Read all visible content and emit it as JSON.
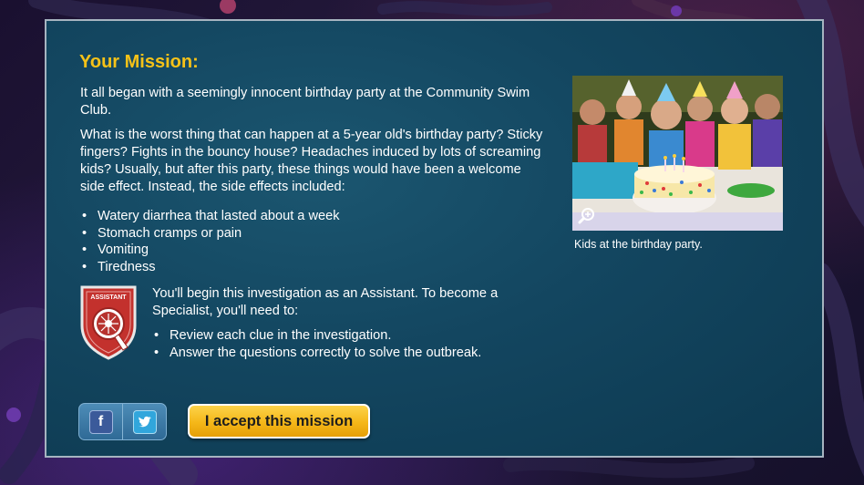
{
  "mission": {
    "title": "Your Mission:",
    "intro": "It all began with a seemingly innocent birthday party at the Community Swim Club.",
    "question": "What is the worst thing that can happen at a 5-year old's birthday party? Sticky fingers? Fights in the bouncy house? Headaches induced by lots of screaming kids? Usually, but after this party, these things would have been a welcome side effect. Instead, the side effects included:",
    "symptoms": [
      "Watery diarrhea that lasted about a week",
      "Stomach cramps or pain",
      "Vomiting",
      "Tiredness"
    ],
    "badge_label": "ASSISTANT",
    "role_text": "You'll begin this investigation as an Assistant. To become a Specialist, you'll need to:",
    "tasks": [
      "Review each clue in the investigation.",
      "Answer the questions correctly to solve the outbreak."
    ]
  },
  "photo": {
    "caption": "Kids at the birthday party."
  },
  "social": {
    "facebook": "f",
    "twitter": "t"
  },
  "accept_label": "I accept this mission",
  "colors": {
    "title": "#f6c218",
    "panel": "#134660",
    "accept": "#f5b718",
    "badge": "#c3312d"
  }
}
